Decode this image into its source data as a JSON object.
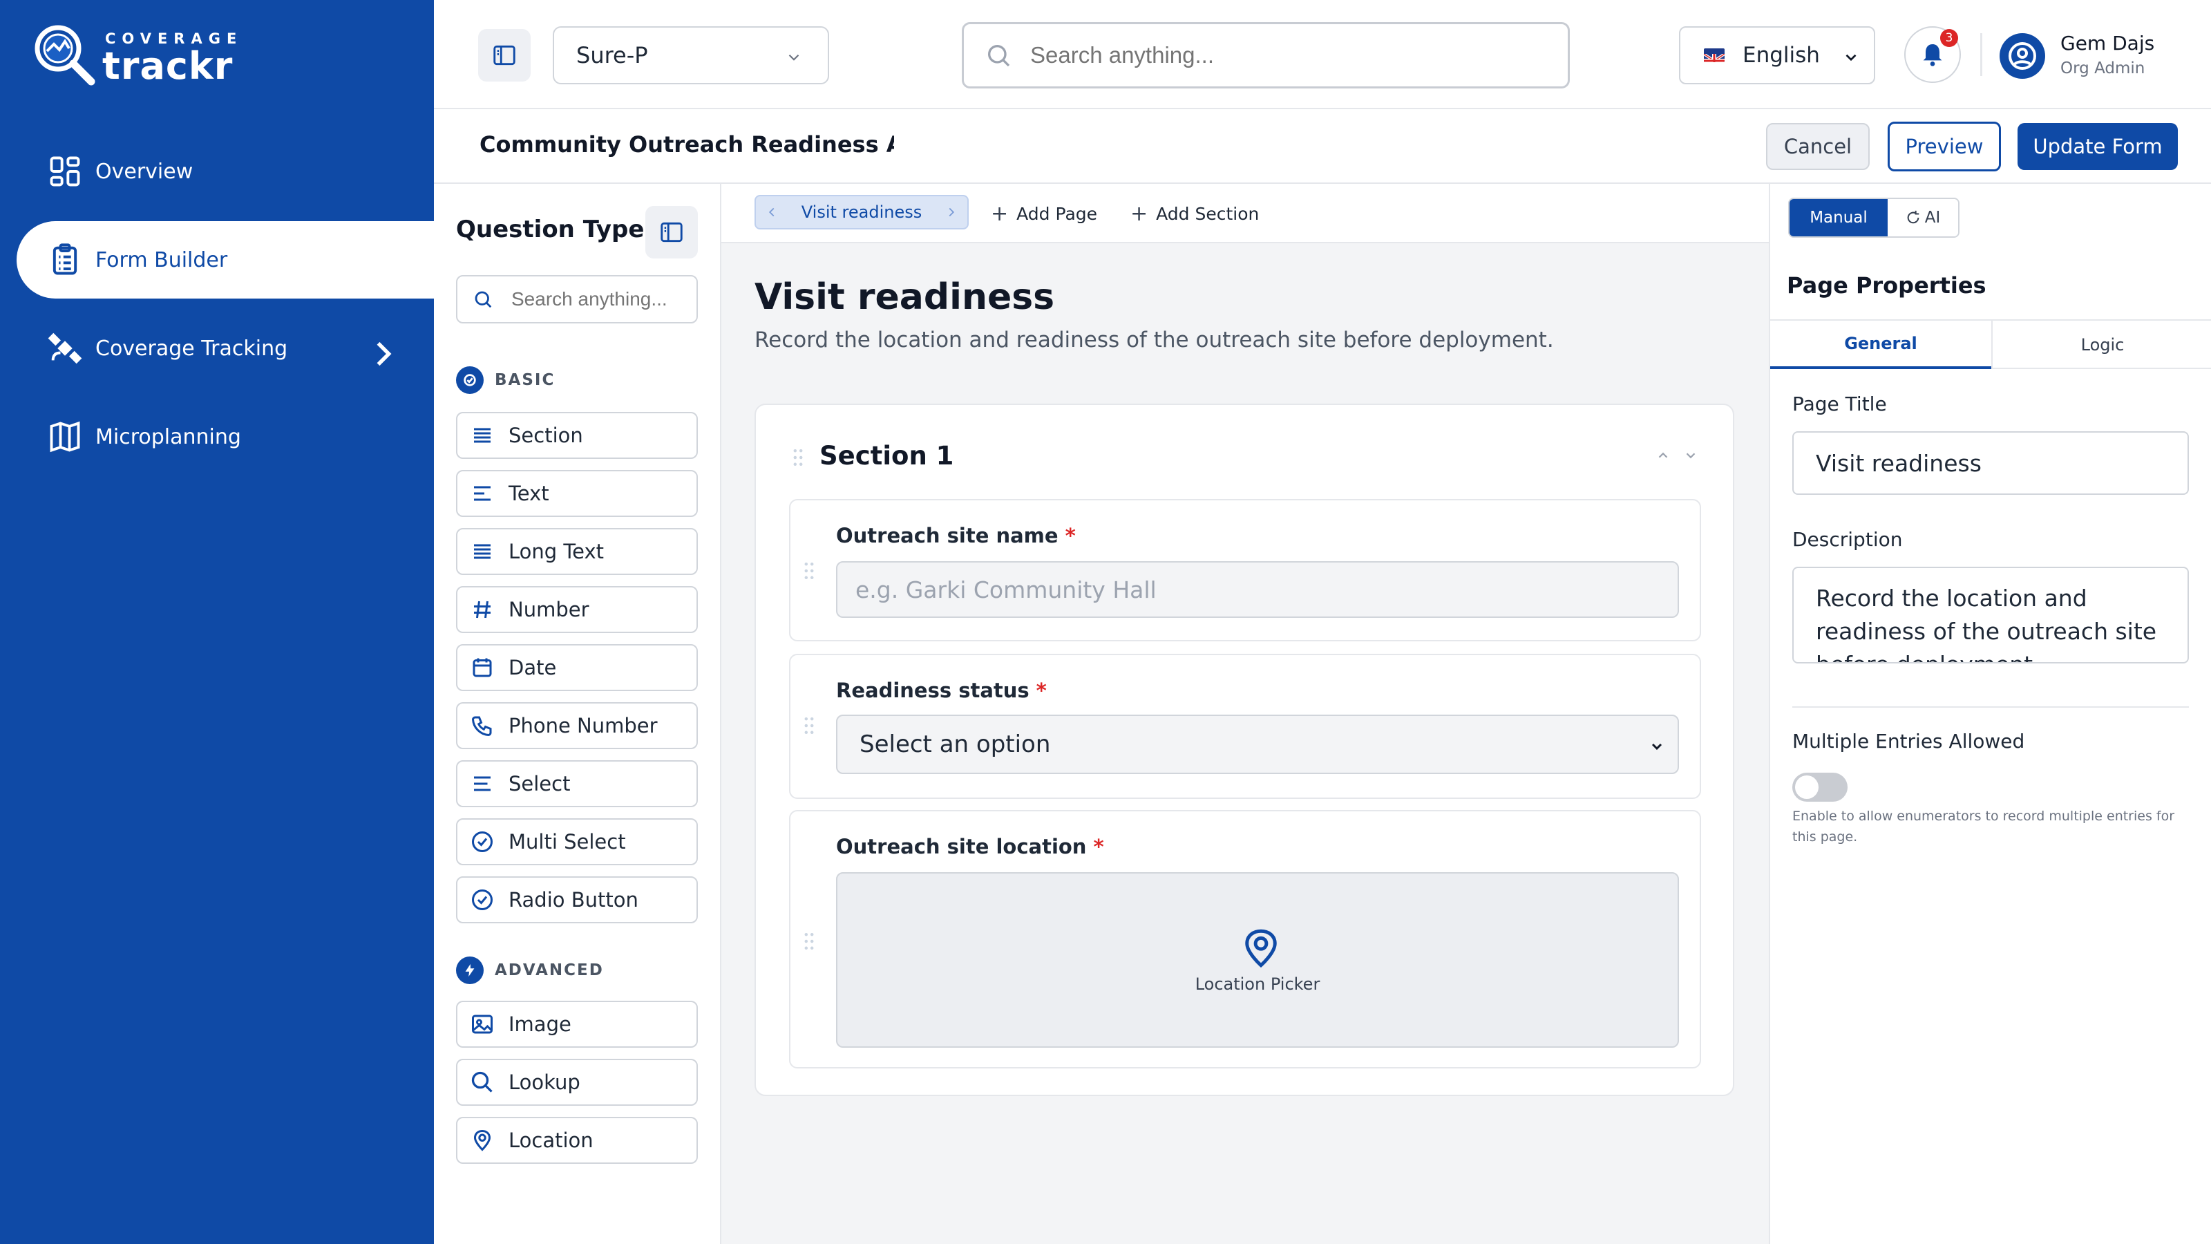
{
  "brand": {
    "small": "COVERAGE",
    "big": "trackr"
  },
  "sidebar": {
    "items": [
      {
        "label": "Overview",
        "icon": "grid-icon"
      },
      {
        "label": "Form Builder",
        "icon": "clipboard-icon"
      },
      {
        "label": "Coverage Tracking",
        "icon": "satellite-icon"
      },
      {
        "label": "Microplanning",
        "icon": "map-icon"
      }
    ]
  },
  "topbar": {
    "project": "Sure-P",
    "search_placeholder": "Search anything...",
    "language": "English",
    "notifications": "3",
    "user_name": "Gem Dajs",
    "user_role": "Org Admin"
  },
  "form": {
    "title": "Community Outreach Readiness Assessment",
    "cancel": "Cancel",
    "preview": "Preview",
    "update": "Update Form"
  },
  "question_panel": {
    "title": "Question Type",
    "search_placeholder": "Search anything...",
    "basic_label": "BASIC",
    "basic": [
      "Section",
      "Text",
      "Long Text",
      "Number",
      "Date",
      "Phone Number",
      "Select",
      "Multi Select",
      "Radio Button"
    ],
    "advanced_label": "ADVANCED",
    "advanced": [
      "Image",
      "Lookup",
      "Location"
    ]
  },
  "canvas": {
    "page_tab": "Visit readiness",
    "add_page": "Add Page",
    "add_section": "Add Section",
    "page_title": "Visit readiness",
    "page_description": "Record the location and readiness of the outreach site before deployment.",
    "section_title": "Section 1",
    "fields": [
      {
        "label": "Outreach site name",
        "required": "*",
        "placeholder": "e.g. Garki Community Hall"
      },
      {
        "label": "Readiness status",
        "required": "*",
        "placeholder": "Select an option"
      },
      {
        "label": "Outreach site location",
        "required": "*",
        "placeholder": "Location Picker"
      }
    ]
  },
  "properties": {
    "mode_manual": "Manual",
    "mode_ai": "AI",
    "heading": "Page Properties",
    "tab_general": "General",
    "tab_logic": "Logic",
    "page_title_label": "Page Title",
    "page_title_value": "Visit readiness",
    "description_label": "Description",
    "description_value": "Record the location and readiness of the outreach site before deployment.",
    "multiple_label": "Multiple Entries Allowed",
    "multiple_help": "Enable to allow enumerators to record multiple entries for this page.",
    "multiple_enabled": false
  },
  "colors": {
    "primary": "#0f4aa6",
    "required": "#dc2626",
    "badge": "#dc2626"
  }
}
